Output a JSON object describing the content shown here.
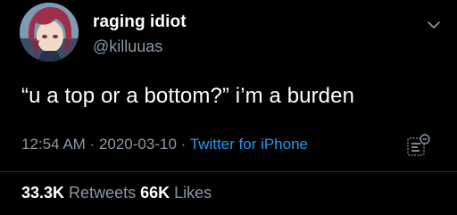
{
  "user": {
    "display_name": "raging idiot",
    "handle": "@killuuas"
  },
  "tweet": {
    "text": "“u a top or a bottom?” i’m a burden",
    "time": "12:54 AM",
    "separator1": " · ",
    "date": "2020-03-10",
    "separator2": " · ",
    "source": "Twitter for iPhone"
  },
  "stats": {
    "retweets_count": "33.3K",
    "retweets_label": " Retweets ",
    "likes_count": "66K",
    "likes_label": " Likes"
  },
  "icons": {
    "chevron": "chevron-down-icon",
    "analytics": "analytics-icon"
  },
  "colors": {
    "background": "#000000",
    "primary_text": "#ffffff",
    "secondary_text": "#8b98a5",
    "link": "#1d9bf0"
  }
}
